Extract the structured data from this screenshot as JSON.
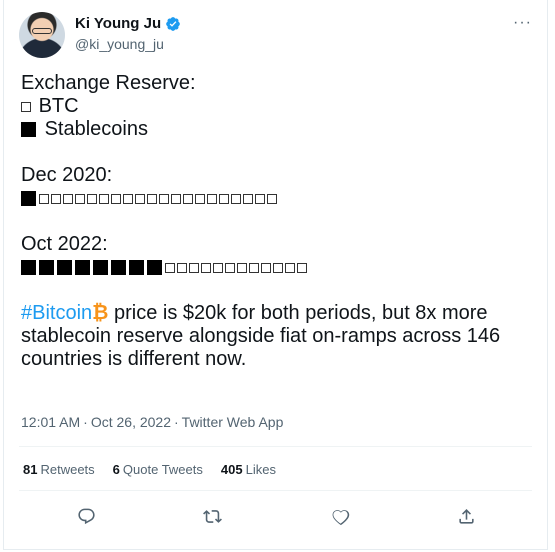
{
  "author": {
    "name": "Ki Young Ju",
    "handle": "@ki_young_ju"
  },
  "menu": {
    "more_label": "···"
  },
  "tweet": {
    "lines": {
      "l1": "Exchange Reserve:",
      "legend_btc": "BTC",
      "legend_stable": "Stablecoins",
      "dec_label": "Dec 2020:",
      "oct_label": "Oct 2022:",
      "hashtag": "#Bitcoin",
      "coin_emoji": "₿",
      "rest1": " price is $20k for both periods, but 8x more",
      "rest2": "stablecoin reserve alongside fiat on-ramps across 146",
      "rest3": "countries is different now."
    },
    "dec_2020": {
      "stablecoin_blocks": 1,
      "btc_blocks": 20
    },
    "oct_2022": {
      "stablecoin_blocks": 8,
      "btc_blocks": 12
    }
  },
  "meta": {
    "time": "12:01 AM",
    "date": "Oct 26, 2022",
    "separator": "·",
    "source": "Twitter Web App"
  },
  "stats": {
    "retweets_count": "81",
    "retweets_label": "Retweets",
    "quotes_count": "6",
    "quotes_label": "Quote Tweets",
    "likes_count": "405",
    "likes_label": "Likes"
  },
  "icons": {
    "verified": "verified-badge-icon",
    "reply": "reply-icon",
    "retweet": "retweet-icon",
    "like": "heart-icon",
    "share": "share-icon"
  },
  "colors": {
    "link": "#1d9bf0",
    "muted": "#536471",
    "text": "#0f1419",
    "bitcoin": "#f7931a"
  }
}
